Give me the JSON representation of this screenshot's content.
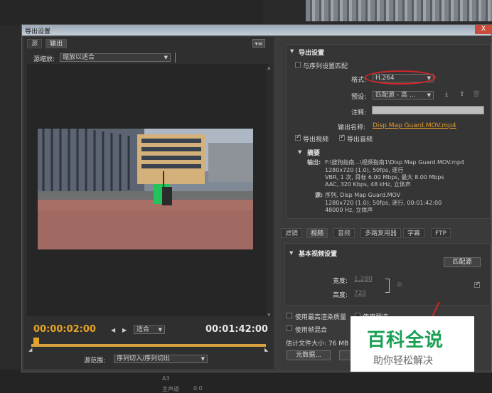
{
  "dialog": {
    "title": "导出设置",
    "close_label": "X"
  },
  "left_panel": {
    "tabs": [
      "源",
      "输出"
    ],
    "panel_menu": "▾≡",
    "scale_label": "源缩放:",
    "scale_value": "缩放以适合",
    "current_time": "00:00:02:00",
    "fit_value": "适合",
    "duration": "00:01:42:00",
    "range_label": "源范围:",
    "range_value": "序列切入/序列切出"
  },
  "export_settings": {
    "header": "导出设置",
    "match_sequence_label": "与序列设置匹配",
    "format_label": "格式:",
    "format_value": "H.264",
    "preset_label": "预设:",
    "preset_value": "匹配源 - 高 ...",
    "comment_label": "注释:",
    "output_name_label": "输出名称:",
    "output_name_value": "Disp Map Guard.MOV.mp4",
    "export_video_label": "导出视频",
    "export_audio_label": "导出音频",
    "summary_header": "摘要",
    "output_label": "输出:",
    "output_lines": [
      "F:\\搜狗指南...\\视频指南1\\Disp Map Guard.MOV.mp4",
      "1280x720 (1.0), 50fps, 逐行",
      "VBR, 1 次, 目标 6.00 Mbps, 最大 8.00 Mbps",
      "AAC, 320 Kbps, 48 kHz, 立体声"
    ],
    "source_label": "源:",
    "source_lines": [
      "序列, Disp Map Guard.MOV",
      "1280x720 (1.0), 50fps, 逐行, 00:01:42:00",
      "48000 Hz, 立体声"
    ]
  },
  "lower_tabs": [
    "滤镜",
    "视频",
    "音频",
    "多路复用器",
    "字幕",
    "FTP"
  ],
  "basic_video": {
    "header": "基本视频设置",
    "match_source_button": "匹配源",
    "width_label": "宽度:",
    "width_value": "1,280",
    "height_label": "高度:",
    "height_value": "720"
  },
  "bottom": {
    "max_render_quality": "使用最高渲染质量",
    "use_preview": "使用预览",
    "use_frame_blending": "使用帧混合",
    "estimated_size_label": "估计文件大小: 76 MB",
    "metadata_button": "元数据..."
  },
  "background": {
    "bottom_labels": [
      "A3",
      "主声道",
      "0.0"
    ]
  },
  "watermark": {
    "title": "百科全说",
    "subtitle": "助你轻松解决"
  },
  "colors": {
    "timecode": "#e3a32a",
    "highlight_ellipse": "#d2262a",
    "watermark_green": "#1aa055"
  }
}
